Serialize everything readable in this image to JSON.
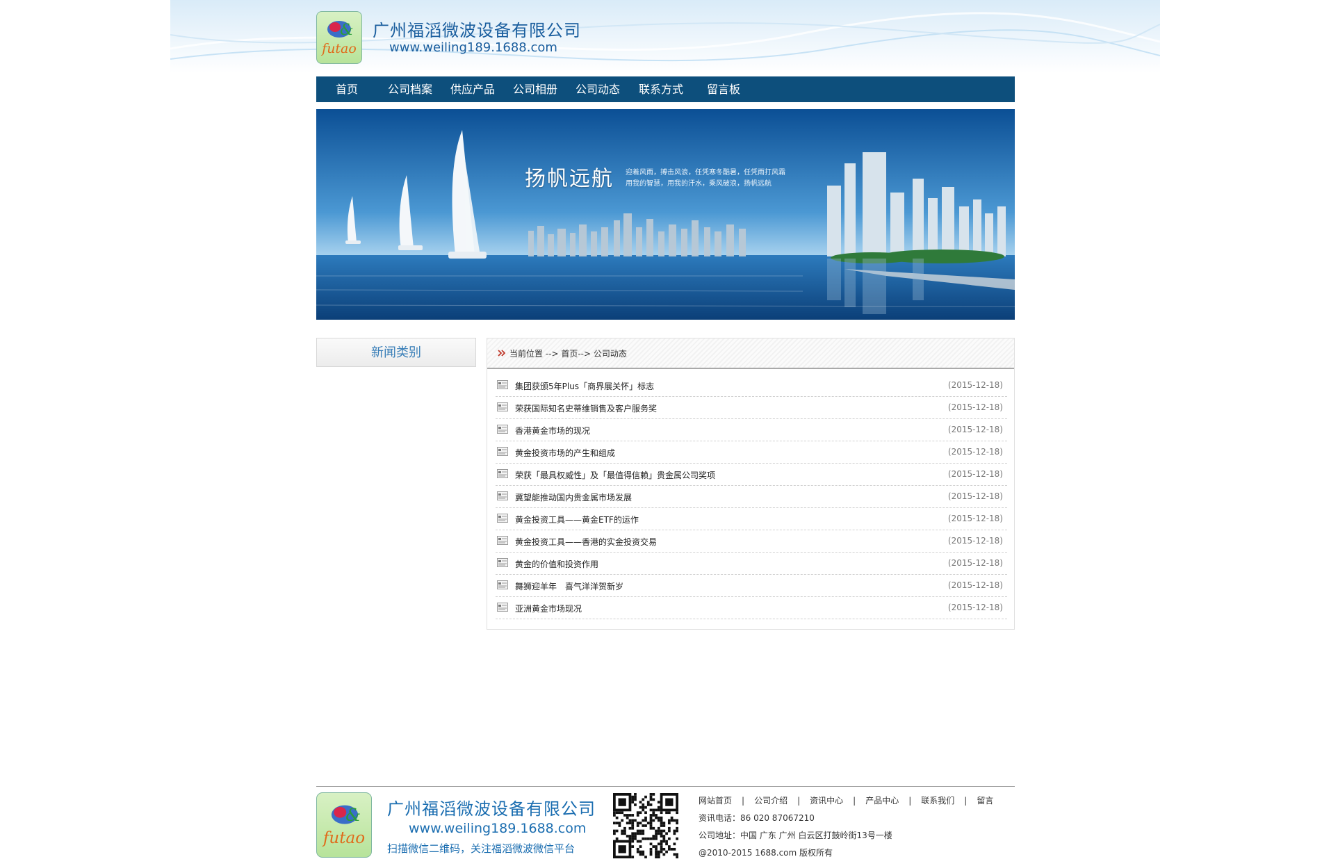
{
  "header": {
    "logo_text": "futao",
    "company_name": "广州福滔微波设备有限公司",
    "url": "www.weiling189.1688.com"
  },
  "nav": {
    "items": [
      "首页",
      "公司档案",
      "供应产品",
      "公司相册",
      "公司动态",
      "联系方式",
      "留言板"
    ]
  },
  "banner": {
    "title": "扬帆远航",
    "line1": "迎着风雨，搏击风浪，任凭寒冬酷暑，任凭雨打风霜",
    "line2": "用我的智慧，用我的汗水，乘风破浪，扬帆远航"
  },
  "sidebar": {
    "heading": "新闻类别"
  },
  "main": {
    "breadcrumb": "当前位置 --> 首页--> 公司动态",
    "news": [
      {
        "title": "集团获颁5年Plus「商界展关怀」标志",
        "date": "(2015-12-18)"
      },
      {
        "title": "荣获国际知名史蒂维销售及客户服务奖",
        "date": "(2015-12-18)"
      },
      {
        "title": "香港黄金市场的现况",
        "date": "(2015-12-18)"
      },
      {
        "title": "黄金投资市场的产生和组成",
        "date": "(2015-12-18)"
      },
      {
        "title": "荣获「最具权威性」及「最值得信赖」贵金属公司奖项",
        "date": "(2015-12-18)"
      },
      {
        "title": "冀望能推动国内贵金属市场发展",
        "date": "(2015-12-18)"
      },
      {
        "title": "黄金投资工具——黄金ETF的运作",
        "date": "(2015-12-18)"
      },
      {
        "title": "黄金投资工具——香港的实金投资交易",
        "date": "(2015-12-18)"
      },
      {
        "title": "黄金的价值和投资作用",
        "date": "(2015-12-18)"
      },
      {
        "title": "舞狮迎羊年　喜气洋洋贺新岁",
        "date": "(2015-12-18)"
      },
      {
        "title": "亚洲黄金市场现况",
        "date": "(2015-12-18)"
      }
    ]
  },
  "footer": {
    "logo_text": "futao",
    "company_name": "广州福滔微波设备有限公司",
    "url": "www.weiling189.1688.com",
    "qr_caption": "扫描微信二维码，关注福滔微波微信平台",
    "links": [
      "网站首页",
      "公司介绍",
      "资讯中心",
      "产品中心",
      "联系我们",
      "留言"
    ],
    "separator": "|",
    "phone": "资讯电话：86 020 87067210",
    "address": "公司地址：中国 广东 广州 白云区打鼓岭街13号一楼",
    "copyright": "@2010-2015 1688.com 版权所有"
  },
  "colors": {
    "nav_bg": "#0d4f7c",
    "brand_blue": "#1a5e9e",
    "banner_sea": "#1a74bd"
  }
}
